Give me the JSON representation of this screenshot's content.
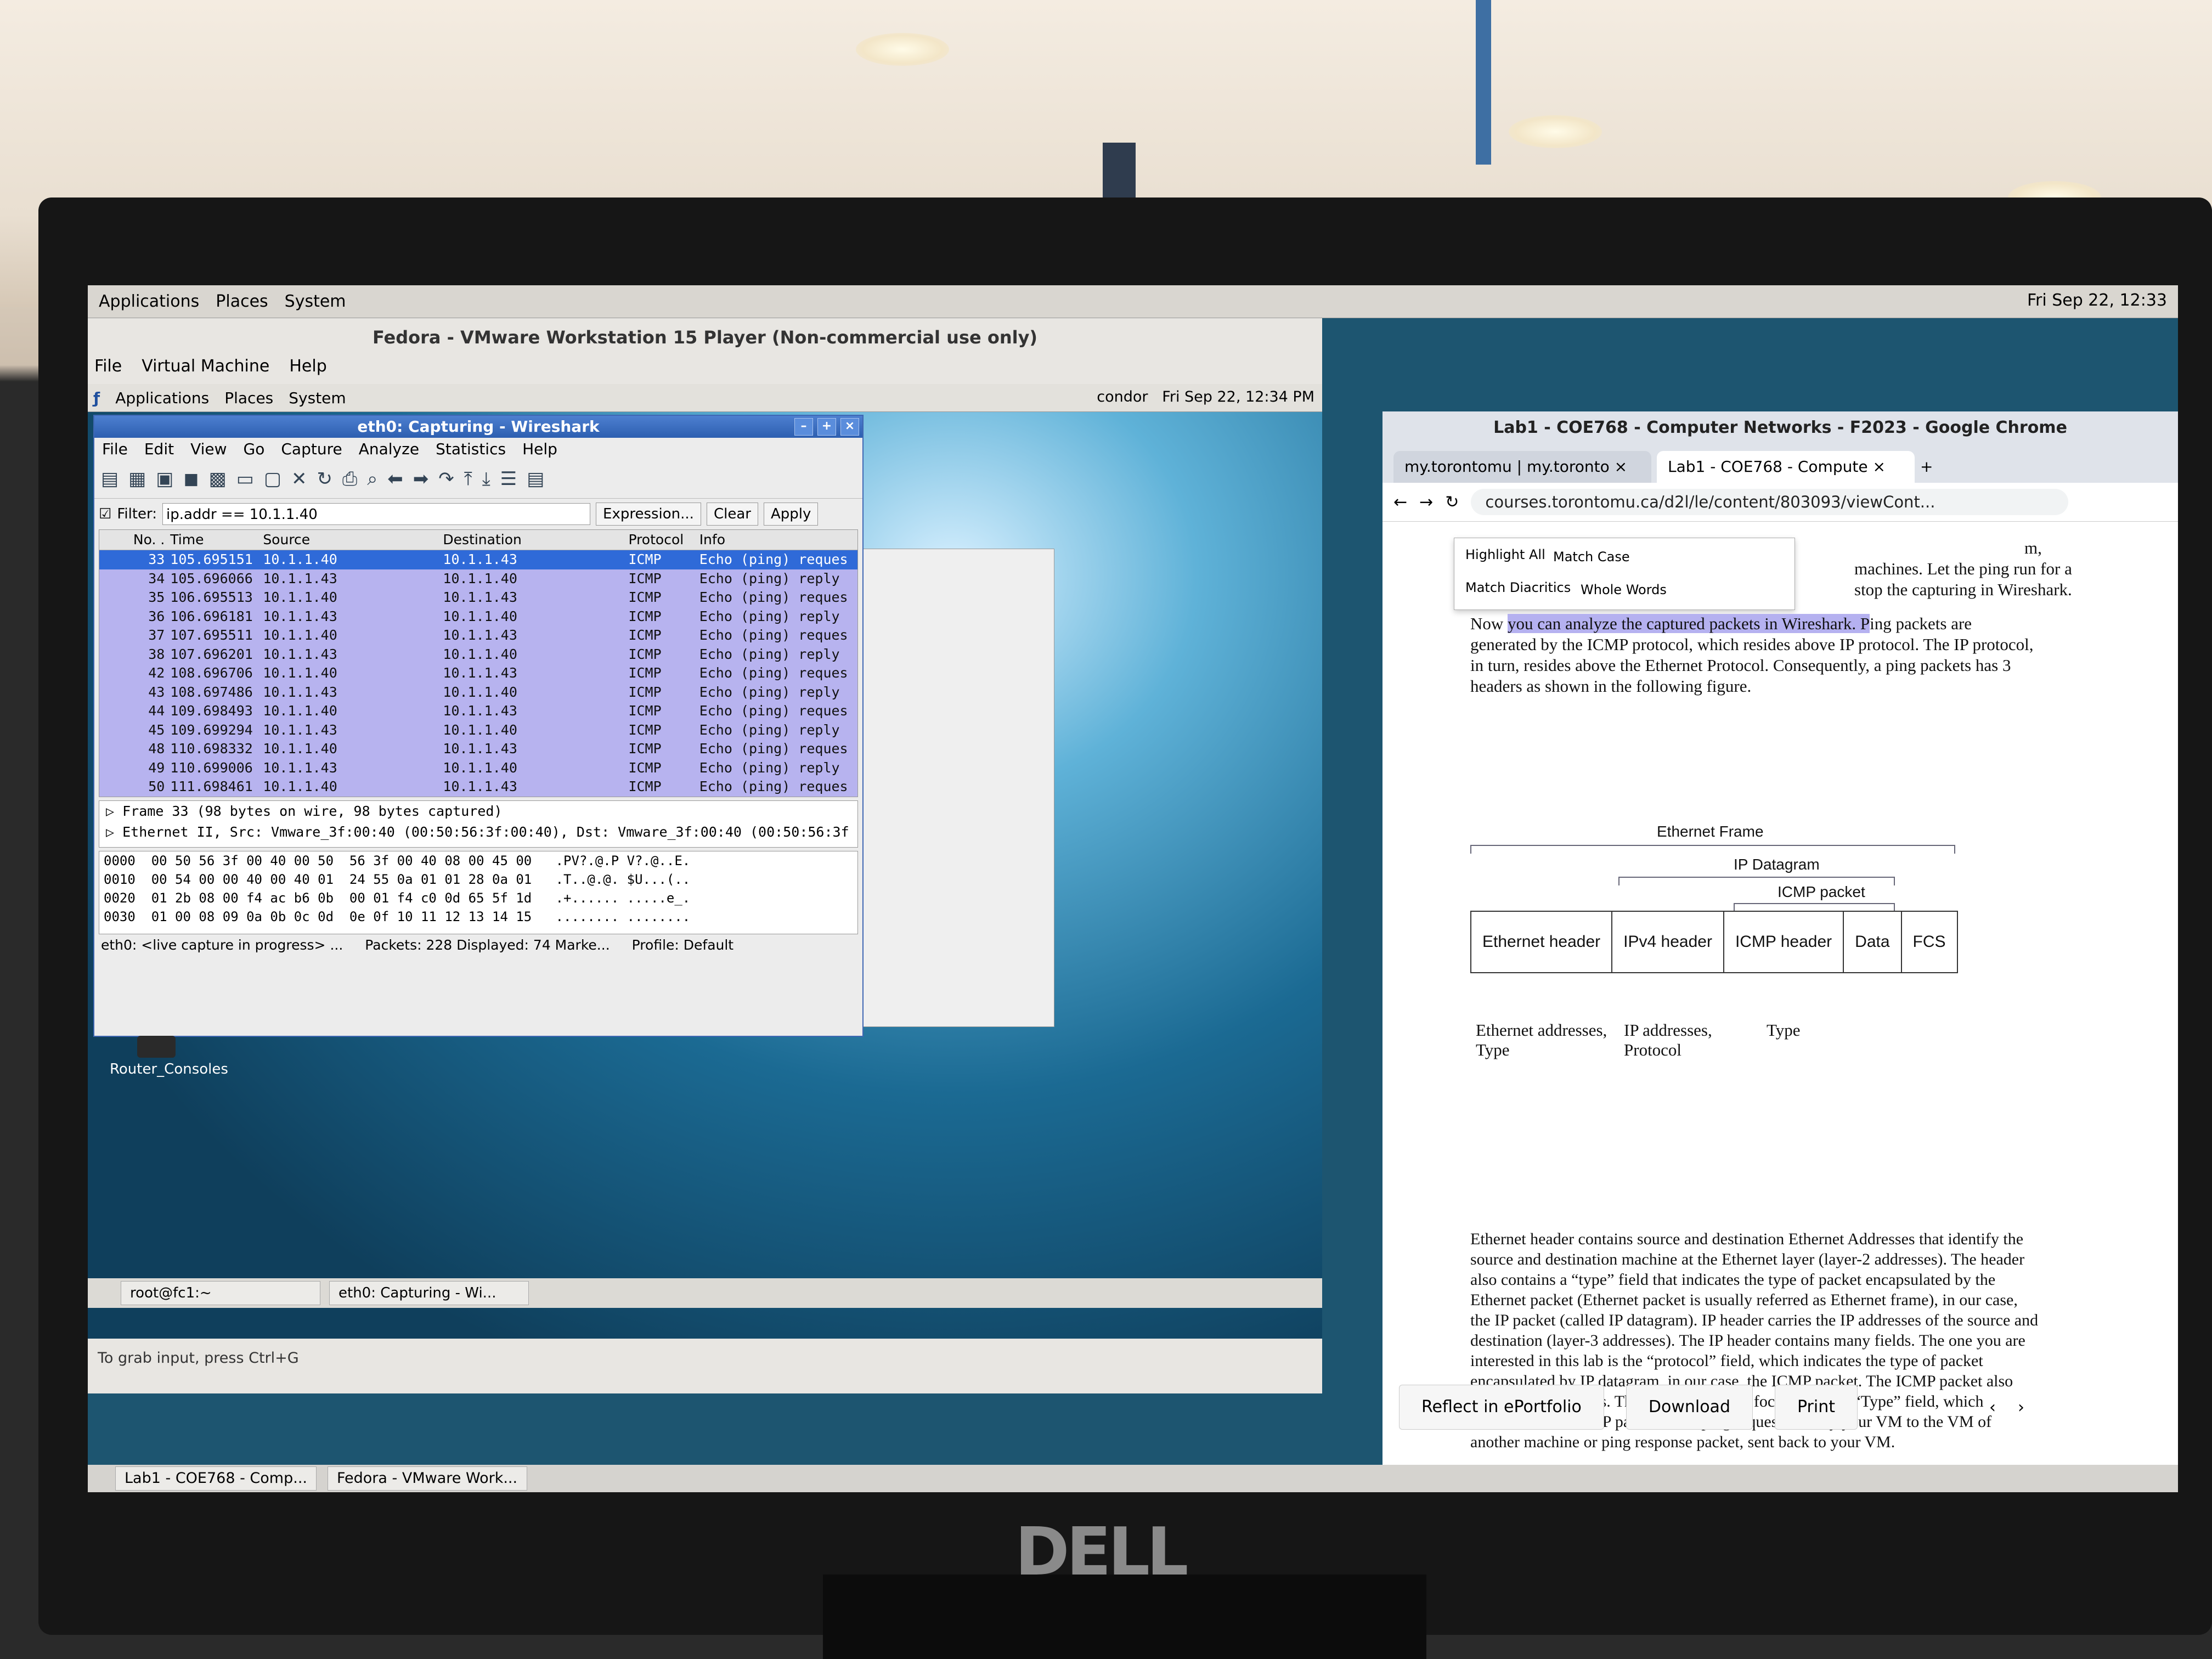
{
  "host": {
    "panel_menu": [
      "Applications",
      "Places",
      "System"
    ],
    "clock": "Fri Sep 22, 12:33",
    "taskbar": [
      "Lab1 - COE768 - Comp...",
      "Fedora - VMware Work..."
    ]
  },
  "vmware": {
    "title": "Fedora - VMware Workstation 15 Player (Non-commercial use only)",
    "menu": [
      "File",
      "Virtual Machine",
      "Help"
    ],
    "status": "To grab input, press Ctrl+G"
  },
  "guest": {
    "panel_menu": [
      "Applications",
      "Places",
      "System"
    ],
    "user": "condor",
    "clock": "Fri Sep 22, 12:34 PM",
    "desktop_icon": "Router_Consoles",
    "taskbar": [
      "root@fc1:~",
      "eth0: Capturing - Wi..."
    ]
  },
  "wireshark": {
    "title": "eth0: Capturing - Wireshark",
    "menu": [
      "File",
      "Edit",
      "View",
      "Go",
      "Capture",
      "Analyze",
      "Statistics",
      "Help"
    ],
    "filter_label": "Filter:",
    "filter_value": "ip.addr == 10.1.1.40",
    "expression_label": "Expression...",
    "clear_label": "Clear",
    "apply_label": "Apply",
    "columns": [
      "No. .",
      "Time",
      "Source",
      "Destination",
      "Protocol",
      "Info"
    ],
    "rows": [
      {
        "no": "33",
        "time": "105.695151",
        "src": "10.1.1.40",
        "dst": "10.1.1.43",
        "proto": "ICMP",
        "info": "Echo (ping) reques"
      },
      {
        "no": "34",
        "time": "105.696066",
        "src": "10.1.1.43",
        "dst": "10.1.1.40",
        "proto": "ICMP",
        "info": "Echo (ping) reply"
      },
      {
        "no": "35",
        "time": "106.695513",
        "src": "10.1.1.40",
        "dst": "10.1.1.43",
        "proto": "ICMP",
        "info": "Echo (ping) reques"
      },
      {
        "no": "36",
        "time": "106.696181",
        "src": "10.1.1.43",
        "dst": "10.1.1.40",
        "proto": "ICMP",
        "info": "Echo (ping) reply"
      },
      {
        "no": "37",
        "time": "107.695511",
        "src": "10.1.1.40",
        "dst": "10.1.1.43",
        "proto": "ICMP",
        "info": "Echo (ping) reques"
      },
      {
        "no": "38",
        "time": "107.696201",
        "src": "10.1.1.43",
        "dst": "10.1.1.40",
        "proto": "ICMP",
        "info": "Echo (ping) reply"
      },
      {
        "no": "42",
        "time": "108.696706",
        "src": "10.1.1.40",
        "dst": "10.1.1.43",
        "proto": "ICMP",
        "info": "Echo (ping) reques"
      },
      {
        "no": "43",
        "time": "108.697486",
        "src": "10.1.1.43",
        "dst": "10.1.1.40",
        "proto": "ICMP",
        "info": "Echo (ping) reply"
      },
      {
        "no": "44",
        "time": "109.698493",
        "src": "10.1.1.40",
        "dst": "10.1.1.43",
        "proto": "ICMP",
        "info": "Echo (ping) reques"
      },
      {
        "no": "45",
        "time": "109.699294",
        "src": "10.1.1.43",
        "dst": "10.1.1.40",
        "proto": "ICMP",
        "info": "Echo (ping) reply"
      },
      {
        "no": "48",
        "time": "110.698332",
        "src": "10.1.1.40",
        "dst": "10.1.1.43",
        "proto": "ICMP",
        "info": "Echo (ping) reques"
      },
      {
        "no": "49",
        "time": "110.699006",
        "src": "10.1.1.43",
        "dst": "10.1.1.40",
        "proto": "ICMP",
        "info": "Echo (ping) reply"
      },
      {
        "no": "50",
        "time": "111.698461",
        "src": "10.1.1.40",
        "dst": "10.1.1.43",
        "proto": "ICMP",
        "info": "Echo (ping) reques"
      }
    ],
    "details": [
      "Frame 33 (98 bytes on wire, 98 bytes captured)",
      "Ethernet II, Src: Vmware_3f:00:40 (00:50:56:3f:00:40), Dst: Vmware_3f:00:40 (00:50:56:3f"
    ],
    "bytes": [
      "0000  00 50 56 3f 00 40 00 50  56 3f 00 40 08 00 45 00   .PV?.@.P V?.@..E.",
      "0010  00 54 00 00 40 00 40 01  24 55 0a 01 01 28 0a 01   .T..@.@. $U...(..",
      "0020  01 2b 08 00 f4 ac b6 0b  00 01 f4 c0 0d 65 5f 1d   .+...... .....e_.",
      "0030  01 00 08 09 0a 0b 0c 0d  0e 0f 10 11 12 13 14 15   ........ ........"
    ],
    "status_capture": "eth0: <live capture in progress> ...",
    "status_packets": "Packets: 228 Displayed: 74 Marke...",
    "status_profile": "Profile: Default"
  },
  "chrome": {
    "title": "Lab1 - COE768 - Computer Networks - F2023 - Google Chrome",
    "tabs": [
      "my.torontomu | my.toronto",
      "Lab1 - COE768 - Compute"
    ],
    "url": "courses.torontomu.ca/d2l/le/content/803093/viewCont...",
    "find_options": [
      "Highlight All",
      "Match Case",
      "Match Diacritics",
      "Whole Words"
    ],
    "frag1": "m,",
    "frag2": "machines. Let the ping run for a",
    "frag3": "stop the capturing in Wireshark.",
    "para1_pre": "Now ",
    "para1_hl": "you can analyze the captured packets in Wireshark. P",
    "para1_post": "ing packets are generated by the ICMP protocol, which resides above IP protocol. The IP protocol,  in turn, resides above the Ethernet Protocol. Consequently, a ping packets has 3  headers as shown in the following figure.",
    "fig_ethernet_frame": "Ethernet Frame",
    "fig_ip_datagram": "IP Datagram",
    "fig_icmp_packet": "ICMP packet",
    "fig_boxes": [
      "Ethernet header",
      "IPv4 header",
      "ICMP header",
      "Data",
      "FCS"
    ],
    "fig_caption1": "Ethernet addresses, Type",
    "fig_caption2": "IP addresses, Protocol",
    "fig_caption3": "Type",
    "para2": "Ethernet header contains source and destination Ethernet Addresses that identify  the source and destination machine at the Ethernet layer (layer-2 addresses). The  header also contains a “type” field that indicates the type of packet encapsulated  by the Ethernet packet (Ethernet packet is usually referred as Ethernet frame), in  our case, the IP packet (called IP datagram). IP header carries the IP addresses of  the source and destination (layer-3 addresses). The IP header contains many fields. The one you are  interested in this lab is the “protocol” field, which indicates the type of packet encapsulated by IP datagram, in our case, the ICMP packet. The ICMP packet also contains many fields. The one you want to focus on is the “Type” field, which indicates if the ICMP packet is the ping request, sent by your VM to the VM of another machine or  ping response packet, sent back to your VM.",
    "footer": [
      "Reflect in ePortfolio",
      "Download",
      "Print"
    ]
  },
  "monitor_brand": "DELL"
}
